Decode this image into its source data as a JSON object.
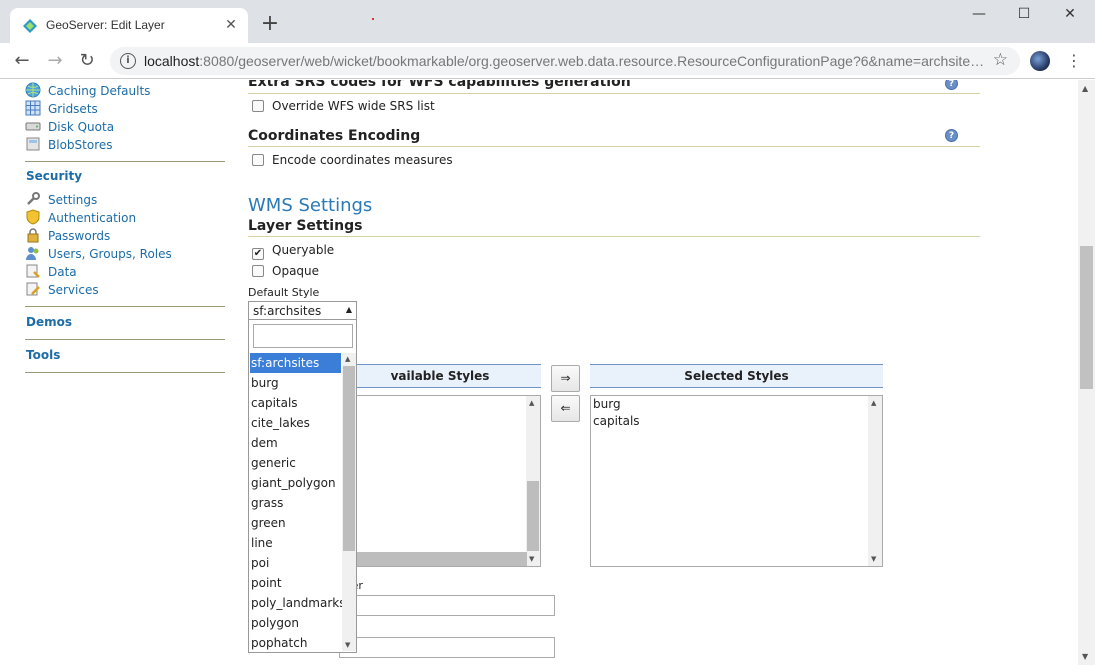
{
  "browser": {
    "tab_title": "GeoServer: Edit Layer",
    "close_tab": "✕",
    "new_tab": "+",
    "url_host": "localhost",
    "url_rest": ":8080/geoserver/web/wicket/bookmarkable/org.geoserver.web.data.resource.ResourceConfigurationPage?6&name=archsite…",
    "win_min": "—",
    "win_max": "☐",
    "win_close": "✕"
  },
  "sidebar": {
    "gwc_items": [
      "Caching Defaults",
      "Gridsets",
      "Disk Quota",
      "BlobStores"
    ],
    "security_heading": "Security",
    "security_items": [
      "Settings",
      "Authentication",
      "Passwords",
      "Users, Groups, Roles",
      "Data",
      "Services"
    ],
    "demos": "Demos",
    "tools": "Tools"
  },
  "main": {
    "extra_srs_title": "Extra SRS codes for WFS capabilities generation",
    "override_srs_label": "Override WFS wide SRS list",
    "coords_title": "Coordinates Encoding",
    "encode_coords_label": "Encode coordinates measures",
    "wms_title": "WMS Settings",
    "layer_settings_title": "Layer Settings",
    "queryable_label": "Queryable",
    "opaque_label": "Opaque",
    "default_style_label": "Default Style",
    "default_style_value": "sf:archsites",
    "style_options": [
      "sf:archsites",
      "burg",
      "capitals",
      "cite_lakes",
      "dem",
      "generic",
      "giant_polygon",
      "grass",
      "green",
      "line",
      "poi",
      "point",
      "poly_landmarks",
      "polygon",
      "pophatch"
    ],
    "available_styles_header": "vailable Styles",
    "selected_styles_header": "Selected Styles",
    "selected_styles": [
      "burg",
      "capitals"
    ],
    "move_right": "⇒",
    "move_left": "⇐",
    "buffer_label": "ffer",
    "help": "?"
  },
  "colors": {
    "link": "#1c6ca8",
    "wms_title": "#2a79b8",
    "selection": "#3b7ed8"
  }
}
